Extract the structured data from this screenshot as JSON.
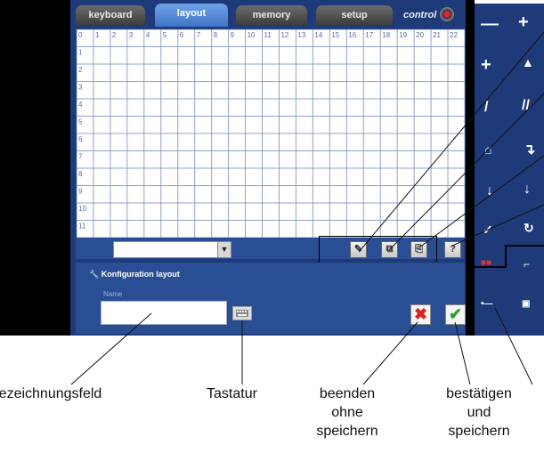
{
  "tabs": [
    {
      "label": "keyboard",
      "active": false
    },
    {
      "label": "layout",
      "active": true
    },
    {
      "label": "memory",
      "active": false
    },
    {
      "label": "setup",
      "active": false
    }
  ],
  "control_label": "control",
  "grid": {
    "column_headers": [
      "0",
      "1",
      "2",
      "3",
      "4",
      "5",
      "6",
      "7",
      "8",
      "9",
      "10",
      "11",
      "12",
      "13",
      "14",
      "15",
      "16",
      "17",
      "18",
      "19",
      "20",
      "21",
      "22"
    ],
    "row_headers": [
      "1",
      "2",
      "3",
      "4",
      "5",
      "6",
      "7",
      "8",
      "9",
      "10",
      "11"
    ]
  },
  "toolbar": {
    "select_value": "",
    "help_label": "?"
  },
  "config": {
    "title": "Konfiguration layout",
    "name_label": "Name",
    "name_value": ""
  },
  "callouts": {
    "name_field": "Bezeichnungsfeld",
    "keyboard": "Tastatur",
    "cancel_line1": "beenden",
    "cancel_line2": "ohne",
    "cancel_line3": "speichern",
    "confirm_line1": "bestätigen",
    "confirm_line2": "und",
    "confirm_line3": "speichern"
  },
  "colors": {
    "panel": "#1e3a78",
    "active_tab": "#4a82d4",
    "grid_line": "#8fa3c8",
    "cancel": "#e02020",
    "confirm": "#2ca02c"
  }
}
